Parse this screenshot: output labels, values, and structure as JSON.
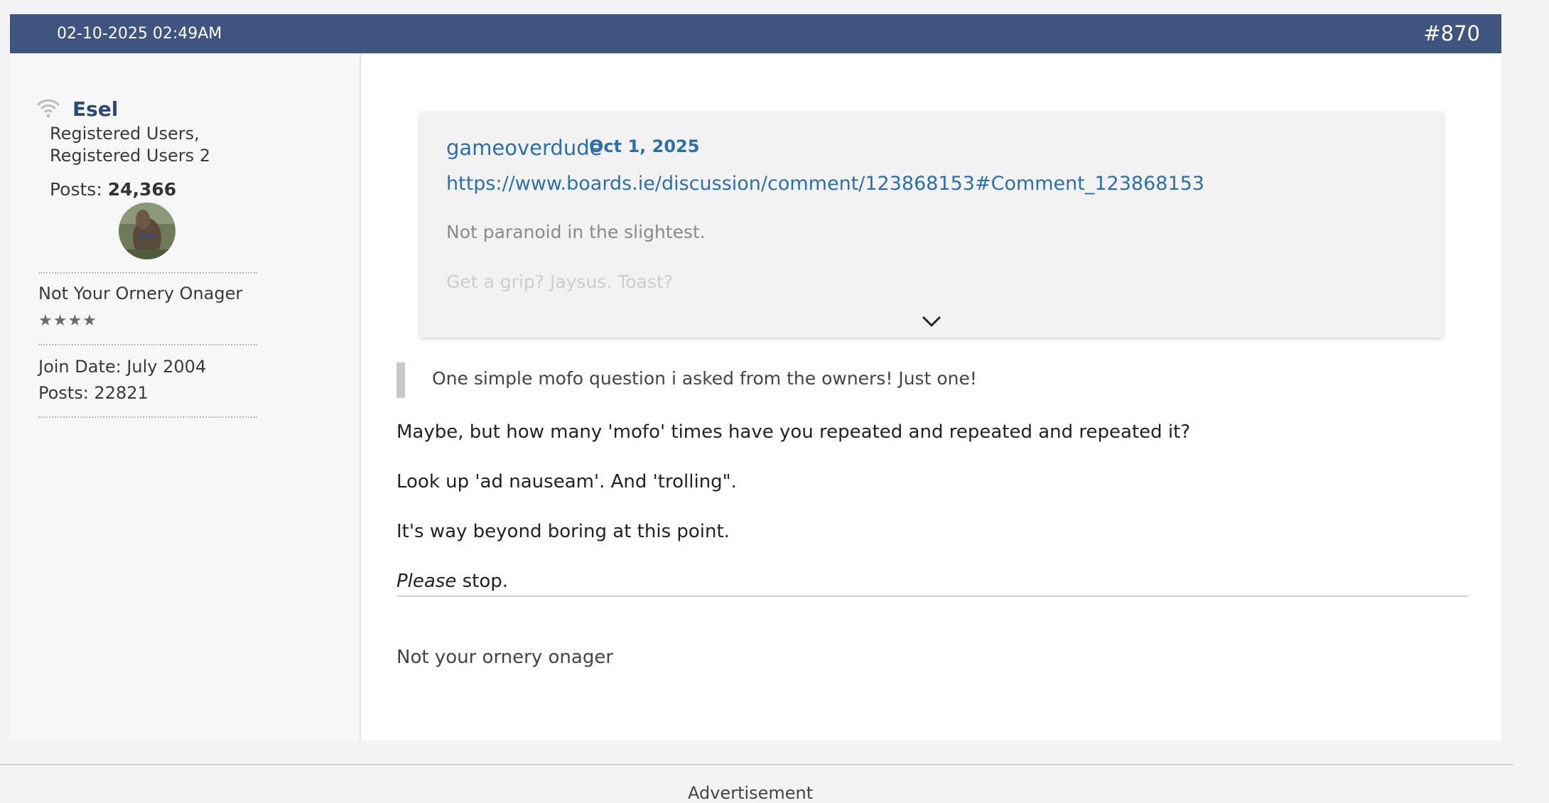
{
  "post": {
    "date": "02-10-2025 02:49AM",
    "number": "#870"
  },
  "user": {
    "name": "Esel",
    "groups": "Registered Users, Registered Users 2",
    "posts_label": "Posts:",
    "posts_count": "24,366",
    "title": "Not Your Ornery Onager",
    "stars": "★★★★",
    "join_date": "Join Date: July 2004",
    "posts_line": "Posts: 22821"
  },
  "quote": {
    "author": "gameoverdude",
    "date": "Oct 1, 2025",
    "link": "https://www.boards.ie/discussion/comment/123868153#Comment_123868153",
    "lines": [
      "Not paranoid in the slightest.",
      "Get a grip? Jaysus. Toast?"
    ]
  },
  "blockquote": "One simple mofo question i asked from the owners! Just one!",
  "body": {
    "line1": "Maybe, but how many 'mofo' times have you repeated and repeated and repeated it?",
    "line2": "Look up 'ad nauseam'. And 'trolling\".",
    "line3": "It's way beyond boring at this point.",
    "please": "Please",
    "stop": " stop."
  },
  "signature": "Not your ornery onager",
  "footer": {
    "advertisement": "Advertisement"
  },
  "colors": {
    "header_bg": "#3f5580",
    "link": "#2d6fa8",
    "username": "#2f4a78"
  },
  "icons": {
    "signal": "wifi-signal-icon",
    "expand": "chevron-down-icon"
  }
}
